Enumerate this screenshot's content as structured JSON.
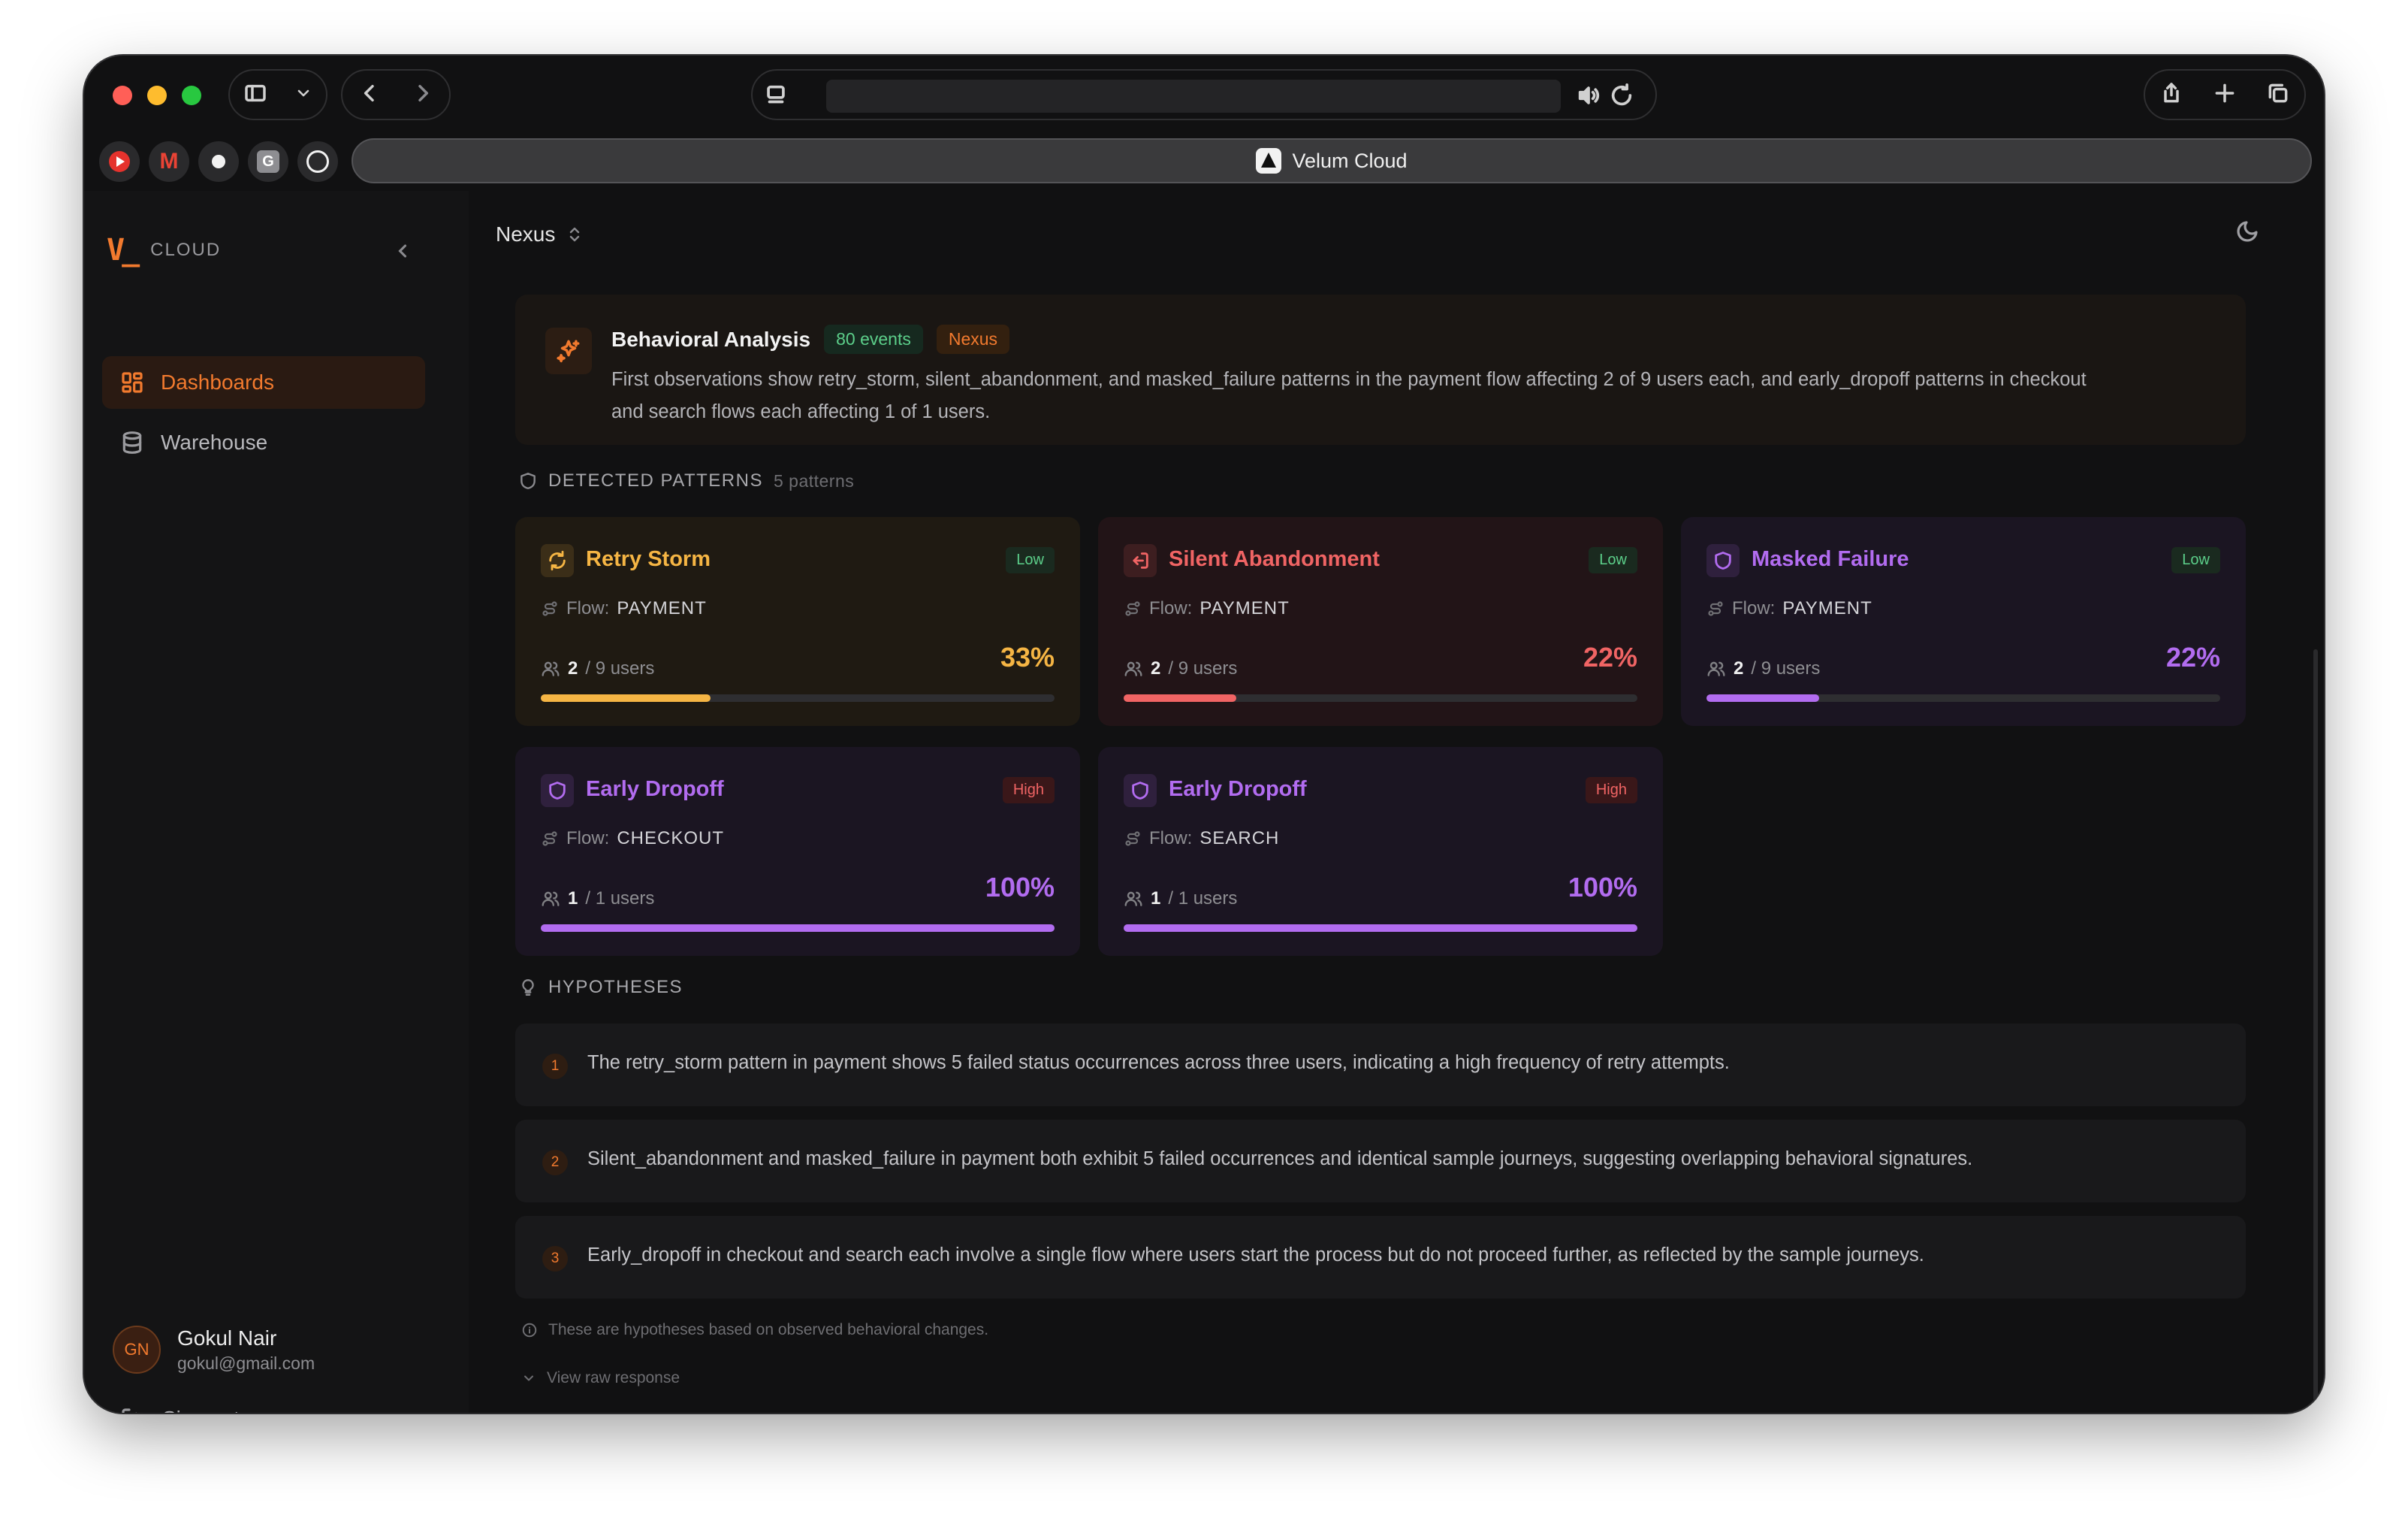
{
  "browser": {
    "tab_title": "Velum Cloud",
    "address": "",
    "favorites": [
      "youtube",
      "gmail",
      "github",
      "g",
      "openai"
    ]
  },
  "sidebar": {
    "brand_mark": "V_",
    "brand_text": "CLOUD",
    "items": [
      {
        "label": "Dashboards",
        "active": true,
        "icon": "grid-icon"
      },
      {
        "label": "Warehouse",
        "active": false,
        "icon": "database-icon"
      }
    ],
    "user": {
      "initials": "GN",
      "name": "Gokul Nair",
      "email": "gokul@gmail.com"
    },
    "signout_label": "Sign out"
  },
  "topbar": {
    "workspace": "Nexus"
  },
  "analysis": {
    "title": "Behavioral Analysis",
    "events_badge": "80 events",
    "source_badge": "Nexus",
    "line1": "First observations show retry_storm, silent_abandonment, and masked_failure patterns in the payment flow affecting 2 of 9 users each, and early_dropoff patterns in checkout",
    "line2": "and search flows each affecting 1 of 1 users."
  },
  "patterns_section": {
    "title": "DETECTED PATTERNS",
    "count": "5 patterns"
  },
  "patterns": [
    {
      "title": "Retry Storm",
      "severity": "Low",
      "flow_label": "Flow:",
      "flow": "PAYMENT",
      "affected": "2",
      "total": "/ 9 users",
      "percent": "33%",
      "fill": 0.33,
      "color": "#f5b544",
      "bg": "#1f1a12",
      "icon": "refresh-icon"
    },
    {
      "title": "Silent Abandonment",
      "severity": "Low",
      "flow_label": "Flow:",
      "flow": "PAYMENT",
      "affected": "2",
      "total": "/ 9 users",
      "percent": "22%",
      "fill": 0.22,
      "color": "#f06464",
      "bg": "#221417",
      "icon": "exit-icon"
    },
    {
      "title": "Masked Failure",
      "severity": "Low",
      "flow_label": "Flow:",
      "flow": "PAYMENT",
      "affected": "2",
      "total": "/ 9 users",
      "percent": "22%",
      "fill": 0.22,
      "color": "#b26cf0",
      "bg": "#1b1522",
      "icon": "shield-icon"
    },
    {
      "title": "Early Dropoff",
      "severity": "High",
      "flow_label": "Flow:",
      "flow": "CHECKOUT",
      "affected": "1",
      "total": "/ 1 users",
      "percent": "100%",
      "fill": 1.0,
      "color": "#b26cf0",
      "bg": "#1b1522",
      "icon": "shield-icon"
    },
    {
      "title": "Early Dropoff",
      "severity": "High",
      "flow_label": "Flow:",
      "flow": "SEARCH",
      "affected": "1",
      "total": "/ 1 users",
      "percent": "100%",
      "fill": 1.0,
      "color": "#b26cf0",
      "bg": "#1b1522",
      "icon": "shield-icon"
    }
  ],
  "hypotheses_section": {
    "title": "HYPOTHESES"
  },
  "hypotheses": [
    {
      "num": "1",
      "text": "The retry_storm pattern in payment shows 5 failed status occurrences across three users, indicating a high frequency of retry attempts."
    },
    {
      "num": "2",
      "text": "Silent_abandonment and masked_failure in payment both exhibit 5 failed occurrences and identical sample journeys, suggesting overlapping behavioral signatures."
    },
    {
      "num": "3",
      "text": "Early_dropoff in checkout and search each involve a single flow where users start the process but do not proceed further, as reflected by the sample journeys."
    }
  ],
  "footnote": "These are hypotheses based on observed behavioral changes.",
  "raw_link": "View raw response"
}
